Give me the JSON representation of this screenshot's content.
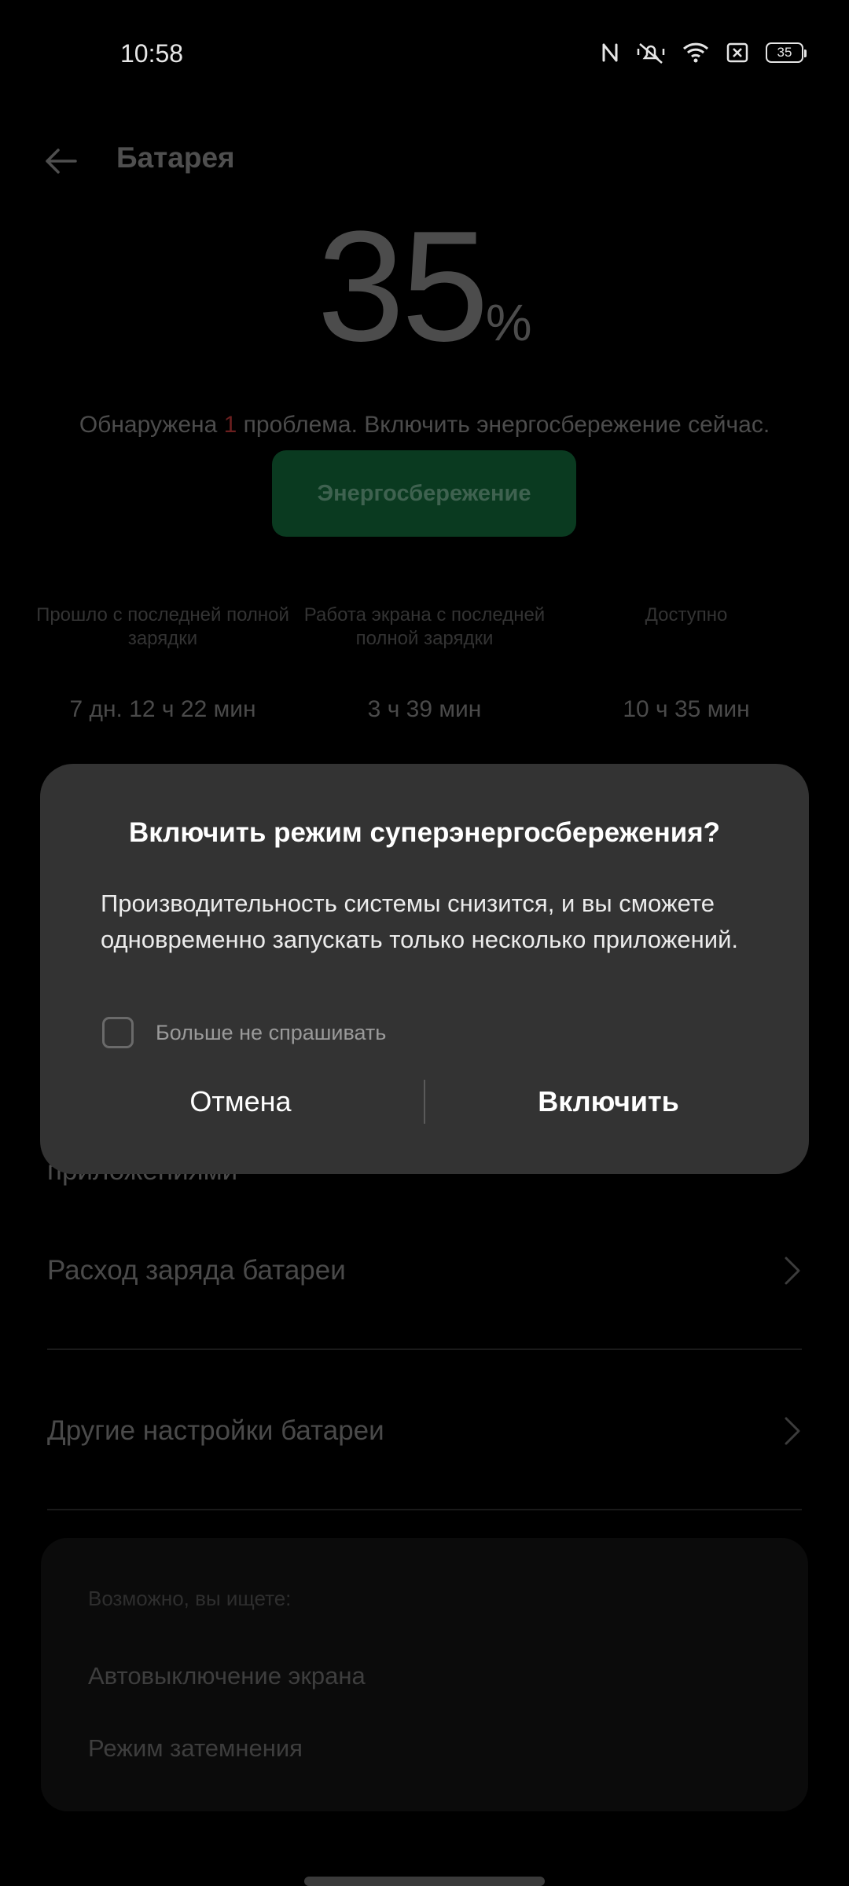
{
  "status_bar": {
    "time": "10:58",
    "icons": [
      "nfc-icon",
      "mute-icon",
      "wifi-icon",
      "sim-x-icon"
    ],
    "battery_level": "35"
  },
  "header": {
    "title": "Батарея"
  },
  "battery": {
    "percent": "35",
    "percent_sign": "%"
  },
  "issue": {
    "prefix": "Обнаружена ",
    "count": "1",
    "suffix": " проблема. Включить энергосбережение сейчас."
  },
  "saver_button_label": "Энергосбережение",
  "stats": [
    {
      "label": "Прошло с последней полной зарядки",
      "value": "7 дн. 12 ч 22 мин"
    },
    {
      "label": "Работа экрана с последней полной зарядки",
      "value": "3 ч 39 мин"
    },
    {
      "label": "Доступно",
      "value": "10 ч 35 мин"
    }
  ],
  "partial_row_text": "приложениями",
  "rows": [
    {
      "label": "Расход заряда батареи"
    },
    {
      "label": "Другие настройки батареи"
    }
  ],
  "suggestions": {
    "heading": "Возможно, вы ищете:",
    "items": [
      "Автовыключение экрана",
      "Режим затемнения"
    ]
  },
  "dialog": {
    "title": "Включить режим суперэнергосбережения?",
    "message": "Производительность системы снизится, и вы сможете одновременно запускать только несколько приложений.",
    "checkbox_label": "Больше не спрашивать",
    "checkbox_checked": false,
    "cancel_label": "Отмена",
    "confirm_label": "Включить"
  }
}
